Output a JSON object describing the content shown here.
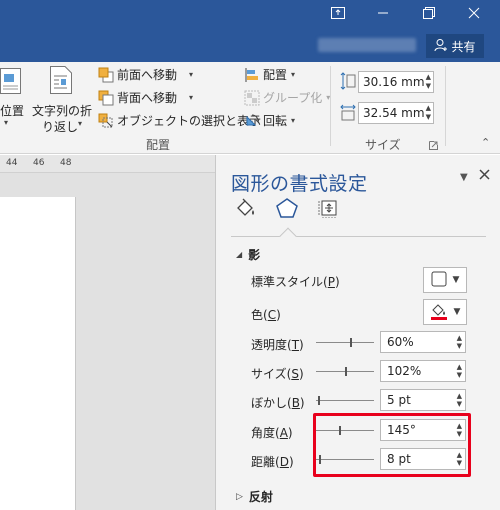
{
  "titlebar": {
    "share_label": "共有",
    "window_buttons": [
      "ribbon-display-icon",
      "minimize-icon",
      "restore-icon",
      "close-icon"
    ]
  },
  "ribbon": {
    "position_label": "位置",
    "wrap_text_line1": "文字列の折",
    "wrap_text_line2": "り返し",
    "bring_forward": "前面へ移動",
    "send_backward": "背面へ移動",
    "selection_pane": "オブジェクトの選択と表示",
    "align": "配置",
    "group": "グループ化",
    "rotate": "回転",
    "arrange_group_label": "配置",
    "height_value": "30.16 mm",
    "width_value": "32.54 mm",
    "size_group_label": "サイズ"
  },
  "ruler": {
    "ticks": [
      "44",
      "46",
      "48"
    ]
  },
  "pane": {
    "title": "図形の書式設定",
    "section_shadow": "影",
    "section_reflection": "反射",
    "preset_label": "標準スタイル(",
    "preset_key": "P",
    "color_label": "色(",
    "color_key": "C",
    "transparency_label": "透明度(",
    "transparency_key": "T",
    "transparency_value": "60%",
    "size_label": "サイズ(",
    "size_key": "S",
    "size_value": "102%",
    "blur_label": "ぼかし(",
    "blur_key": "B",
    "blur_value": "5 pt",
    "angle_label": "角度(",
    "angle_key": "A",
    "angle_value": "145°",
    "distance_label": "距離(",
    "distance_key": "D",
    "distance_value": "8 pt",
    "close_paren": ")",
    "shadow_color": "#e8001c",
    "accent": "#2b579a"
  }
}
